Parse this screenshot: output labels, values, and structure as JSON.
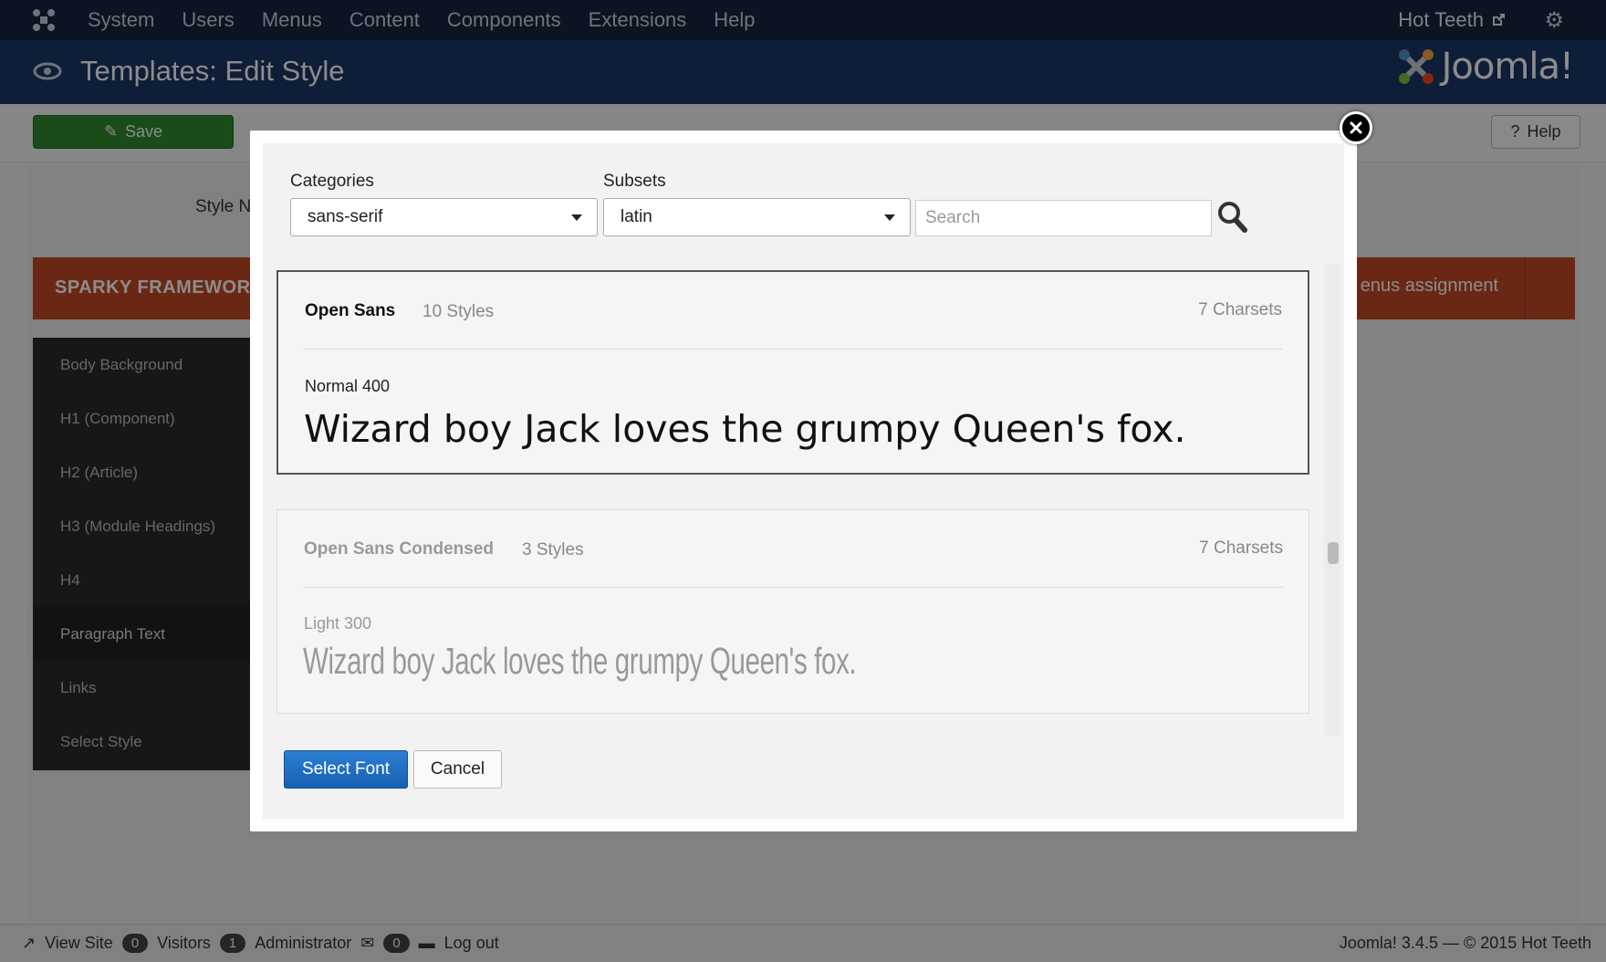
{
  "topnav": {
    "menu": [
      "System",
      "Users",
      "Menus",
      "Content",
      "Components",
      "Extensions",
      "Help"
    ],
    "user": "Hot Teeth"
  },
  "header": {
    "title": "Templates: Edit Style",
    "brand": "Joomla!"
  },
  "toolbar": {
    "save_label": "Save",
    "help_label": "Help"
  },
  "page": {
    "style_name_label": "Style N",
    "framework_label": "SPARKY FRAMEWOR",
    "menus_assignment": "enus assignment"
  },
  "sidebar": {
    "items": [
      {
        "label": "Body Background"
      },
      {
        "label": "H1 (Component)"
      },
      {
        "label": "H2 (Article)"
      },
      {
        "label": "H3 (Module Headings)"
      },
      {
        "label": "H4"
      },
      {
        "label": "Paragraph Text"
      },
      {
        "label": "Links"
      },
      {
        "label": "Select Style"
      }
    ]
  },
  "footer": {
    "view_site": "View Site",
    "visitors_count": "0",
    "visitors": "Visitors",
    "admin_count": "1",
    "administrator": "Administrator",
    "messages_count": "0",
    "logout": "Log out",
    "version": "Joomla! 3.4.5  —  © 2015 Hot Teeth"
  },
  "modal": {
    "categories_label": "Categories",
    "categories_value": "sans-serif",
    "subsets_label": "Subsets",
    "subsets_value": "latin",
    "search_placeholder": "Search",
    "fonts": [
      {
        "name": "Open Sans",
        "styles": "10 Styles",
        "charsets": "7 Charsets",
        "weight": "Normal 400",
        "sample": "Wizard boy Jack loves the grumpy Queen's fox."
      },
      {
        "name": "Open Sans Condensed",
        "styles": "3 Styles",
        "charsets": "7 Charsets",
        "weight": "Light 300",
        "sample": "Wizard boy Jack loves the grumpy Queen's fox."
      }
    ],
    "select_label": "Select Font",
    "cancel_label": "Cancel"
  }
}
